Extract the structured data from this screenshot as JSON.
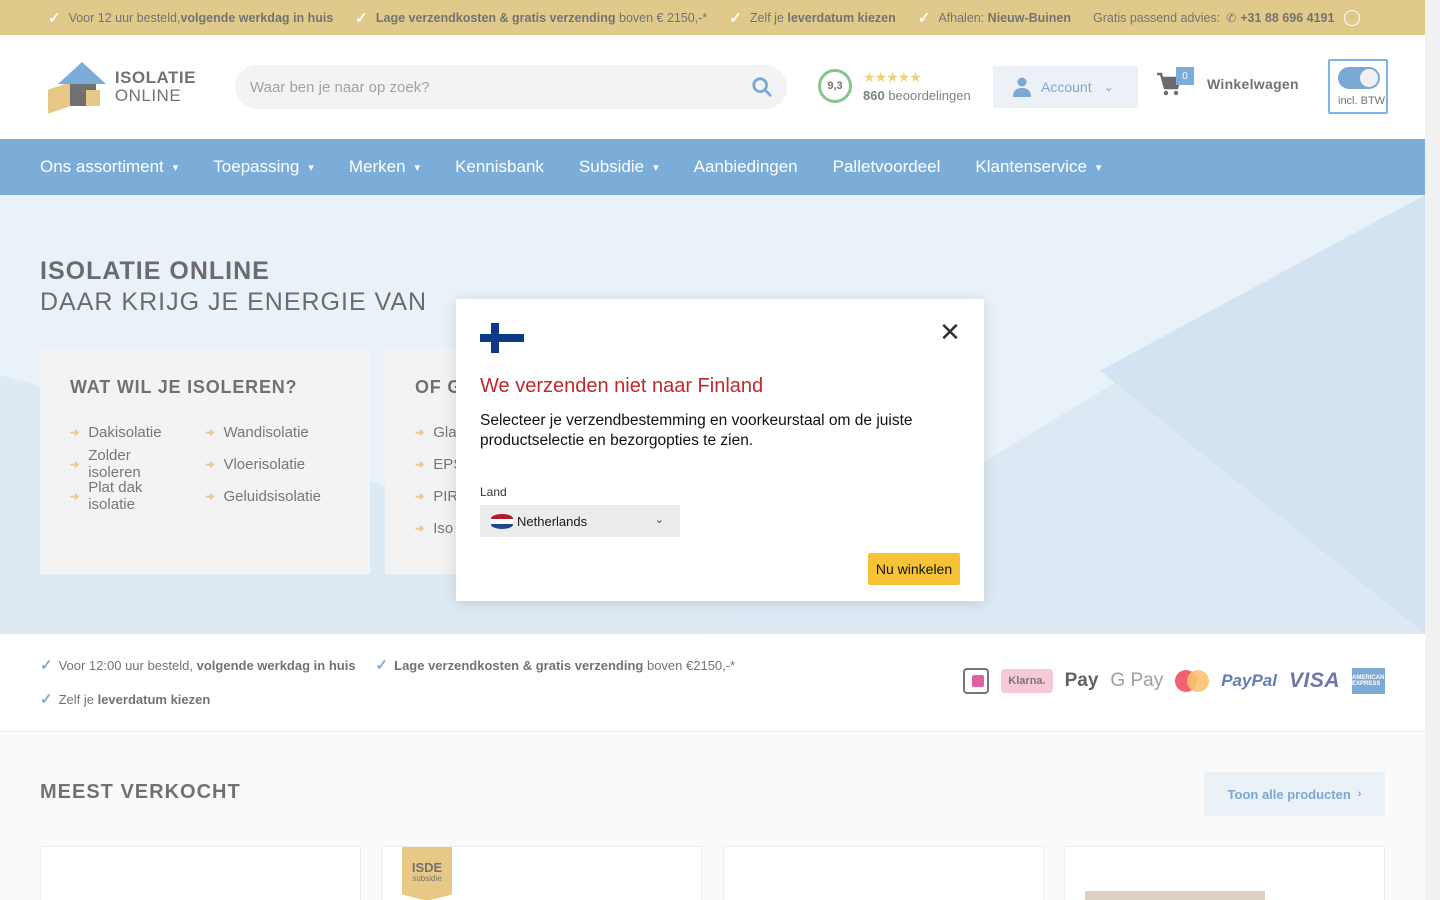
{
  "topbar": {
    "usps": [
      {
        "pre": "Voor 12 uur besteld, ",
        "bold": "volgende werkdag in huis",
        "post": ""
      },
      {
        "pre": "",
        "bold": "Lage verzendkosten & gratis verzending",
        "post": " boven € 2150,-*"
      },
      {
        "pre": "Zelf je ",
        "bold": "leverdatum kiezen",
        "post": ""
      },
      {
        "pre": "Afhalen: ",
        "bold": "Nieuw-Buinen",
        "post": ""
      }
    ],
    "advice_label": "Gratis passend advies:",
    "phone": "+31 88 696 4191"
  },
  "header": {
    "logo_line1": "ISOLATIE",
    "logo_line2": "ONLINE",
    "search_placeholder": "Waar ben je naar op zoek?",
    "rating_score": "9,3",
    "stars": "★★★★★",
    "reviews_count": "860",
    "reviews_label": " beoordelingen",
    "account_label": "Account",
    "cart_count": "0",
    "cart_label": "Winkelwagen",
    "btw_label": "incl. BTW"
  },
  "nav": [
    {
      "label": "Ons assortiment",
      "dropdown": true
    },
    {
      "label": "Toepassing",
      "dropdown": true
    },
    {
      "label": "Merken",
      "dropdown": true
    },
    {
      "label": "Kennisbank",
      "dropdown": false
    },
    {
      "label": "Subsidie",
      "dropdown": true
    },
    {
      "label": "Aanbiedingen",
      "dropdown": false
    },
    {
      "label": "Palletvoordeel",
      "dropdown": false
    },
    {
      "label": "Klantenservice",
      "dropdown": true
    }
  ],
  "hero": {
    "title": "ISOLATIE ONLINE",
    "subtitle": "DAAR KRIJG JE ENERGIE VAN",
    "card1": {
      "title": "WAT WIL JE ISOLEREN?",
      "col1": [
        "Dakisolatie",
        "Zolder isoleren",
        "Plat dak isolatie"
      ],
      "col2": [
        "Wandisolatie",
        "Vloerisolatie",
        "Geluidsisolatie"
      ]
    },
    "card2": {
      "title": "OF G",
      "items": [
        "Gla",
        "EPS",
        "PIR",
        "Iso"
      ]
    }
  },
  "usp2": {
    "line1": [
      {
        "pre": "Voor 12:00 uur besteld, ",
        "bold": "volgende werkdag in huis",
        "post": ""
      },
      {
        "pre": "",
        "bold": "Lage verzendkosten & gratis verzending",
        "post": " boven €2150,-*"
      }
    ],
    "line2": {
      "pre": "Zelf je ",
      "bold": "leverdatum kiezen",
      "post": ""
    },
    "payments": [
      "iDEAL",
      "Klarna.",
      "Pay",
      "G Pay",
      "mastercard",
      "PayPal",
      "VISA",
      "AMERICAN EXPRESS"
    ]
  },
  "best": {
    "title": "MEEST VERKOCHT",
    "show_all": "Toon alle producten",
    "isde": "ISDE",
    "isde_sub": "subsidie"
  },
  "modal": {
    "title": "We verzenden niet naar Finland",
    "text": "Selecteer je verzendbestemming en voorkeurstaal om de juiste productselectie en bezorgopties te zien.",
    "land_label": "Land",
    "country": "Netherlands",
    "cta": "Nu winkelen"
  },
  "colors": {
    "topbar": "#ccaa44",
    "nav": "#2b7bc0",
    "modal_title": "#c1272d",
    "cta": "#f5c335"
  }
}
